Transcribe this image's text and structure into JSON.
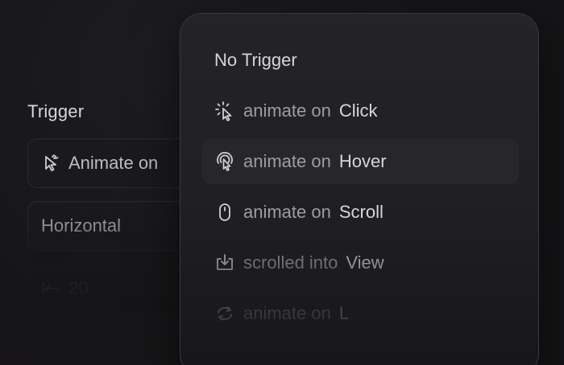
{
  "left_panel": {
    "trigger_label": "Trigger",
    "trigger_field_value": "Animate on",
    "direction_value": "Horizontal",
    "offset_value": "20"
  },
  "menu": {
    "no_trigger_label": "No Trigger",
    "items": [
      {
        "prefix": "animate on",
        "label": "Click",
        "icon": "tap-icon"
      },
      {
        "prefix": "animate on",
        "label": "Hover",
        "icon": "hover-icon"
      },
      {
        "prefix": "animate on",
        "label": "Scroll",
        "icon": "mouse-icon"
      },
      {
        "prefix": "scrolled into",
        "label": "View",
        "icon": "scroll-into-view-icon"
      },
      {
        "prefix": "animate on",
        "label": "L",
        "icon": "loop-icon"
      }
    ]
  },
  "colors": {
    "background": "#161517",
    "menu_bg": "#232225",
    "text_primary": "#d6d6da",
    "text_muted": "#9d9da3"
  }
}
